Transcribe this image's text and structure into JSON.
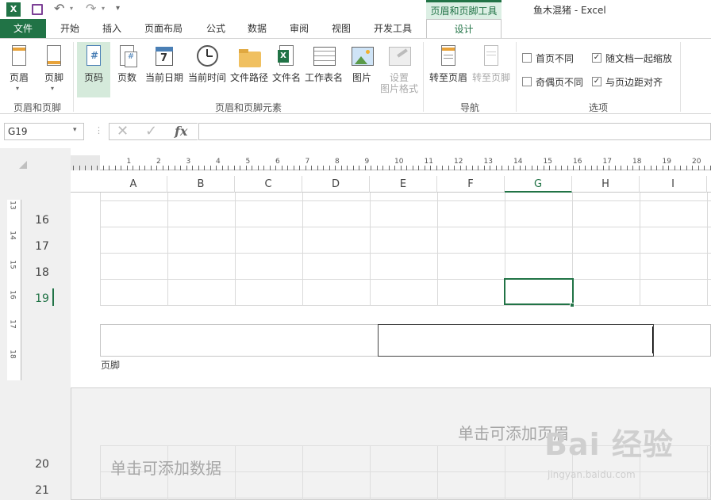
{
  "window": {
    "title": "鱼木混猪 - Excel",
    "context_tab": "页眉和页脚工具"
  },
  "tabs": [
    "文件",
    "开始",
    "插入",
    "页面布局",
    "公式",
    "数据",
    "审阅",
    "视图",
    "开发工具",
    "设计"
  ],
  "ribbon": {
    "hf_group": {
      "label": "页眉和页脚",
      "buttons": [
        "页眉",
        "页脚"
      ]
    },
    "elements_group": {
      "label": "页眉和页脚元素",
      "buttons": [
        "页码",
        "页数",
        "当前日期",
        "当前时间",
        "文件路径",
        "文件名",
        "工作表名",
        "图片",
        "设置",
        "图片格式"
      ]
    },
    "nav_group": {
      "label": "导航",
      "buttons": [
        "转至页眉",
        "转至页脚"
      ]
    },
    "options_group": {
      "label": "选项",
      "options": [
        {
          "label": "首页不同",
          "checked": false
        },
        {
          "label": "随文档一起缩放",
          "checked": true
        },
        {
          "label": "奇偶页不同",
          "checked": false
        },
        {
          "label": "与页边距对齐",
          "checked": true
        }
      ]
    }
  },
  "formula_bar": {
    "name_box": "G19",
    "fx": "fx",
    "formula": ""
  },
  "ruler": {
    "marks": [
      "1",
      "2",
      "3",
      "4",
      "5",
      "6",
      "7",
      "8",
      "9",
      "10",
      "11",
      "12",
      "13",
      "14",
      "15",
      "16",
      "17",
      "18",
      "19",
      "20"
    ]
  },
  "vruler": {
    "marks": [
      "13",
      "14",
      "15",
      "16",
      "17",
      "18"
    ]
  },
  "columns": [
    "A",
    "B",
    "C",
    "D",
    "E",
    "F",
    "G",
    "H",
    "I"
  ],
  "rows_page1": [
    "16",
    "17",
    "18",
    "19"
  ],
  "rows_page2": [
    "20",
    "21"
  ],
  "footer_label": "页脚",
  "page2": {
    "header_placeholder": "单击可添加页眉",
    "data_placeholder": "单击可添加数据"
  },
  "watermark": {
    "text": "Bai 经验",
    "sub": "jingyan.baidu.com"
  },
  "colors": {
    "accent": "#217346"
  }
}
